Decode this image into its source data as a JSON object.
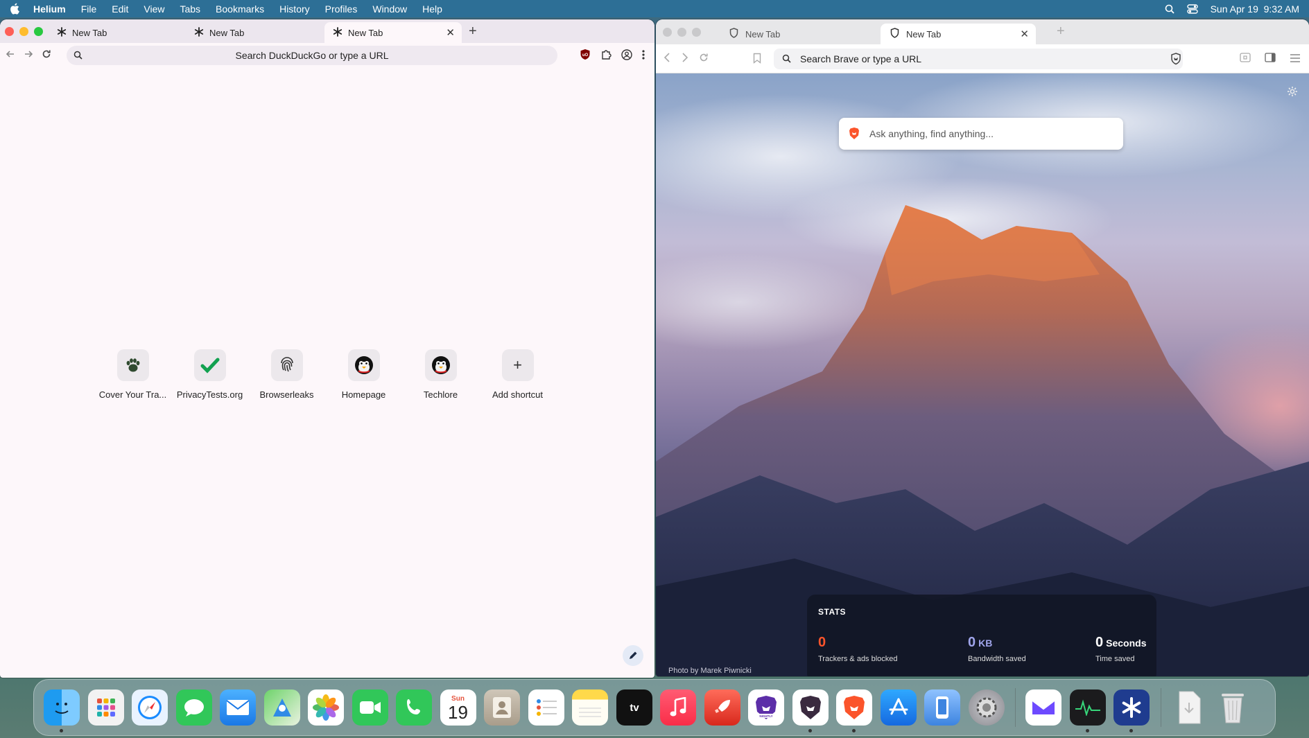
{
  "menubar": {
    "app_name": "Helium",
    "items": [
      "File",
      "Edit",
      "View",
      "Tabs",
      "Bookmarks",
      "History",
      "Profiles",
      "Window",
      "Help"
    ],
    "datetime": "Sun Apr 19  9:32 AM"
  },
  "helium": {
    "tabs": [
      {
        "title": "New Tab",
        "active": false
      },
      {
        "title": "New Tab",
        "active": false
      },
      {
        "title": "New Tab",
        "active": true
      }
    ],
    "new_tab_glyph": "+",
    "omnibox_placeholder": "Search DuckDuckGo or type a URL",
    "shortcuts": [
      {
        "label": "Cover Your Tra...",
        "icon": "bear-paw-icon"
      },
      {
        "label": "PrivacyTests.org",
        "icon": "checkmark-icon"
      },
      {
        "label": "Browserleaks",
        "icon": "fingerprint-icon"
      },
      {
        "label": "Homepage",
        "icon": "penguin-icon"
      },
      {
        "label": "Techlore",
        "icon": "penguin-icon"
      },
      {
        "label": "Add shortcut",
        "icon": "plus-icon"
      }
    ],
    "add_glyph": "+"
  },
  "brave": {
    "tabs": [
      {
        "title": "New Tab",
        "active": false
      },
      {
        "title": "New Tab",
        "active": true
      }
    ],
    "new_tab_glyph": "+",
    "omnibox_placeholder": "Search Brave or type a URL",
    "ntp_search_placeholder": "Ask anything, find anything...",
    "photo_credit": "Photo by Marek Piwnicki",
    "stats": {
      "title": "STATS",
      "trackers": {
        "value": "0",
        "unit": "",
        "caption": "Trackers & ads blocked",
        "color": "#fb542b"
      },
      "bandwidth": {
        "value": "0",
        "unit": "KB",
        "caption": "Bandwidth saved",
        "color": "#a0a5eb"
      },
      "time": {
        "value": "0",
        "unit": "Seconds",
        "caption": "Time saved",
        "color": "#ffffff"
      }
    }
  },
  "calendar": {
    "weekday": "Sun",
    "day": "19"
  },
  "dock": {
    "apps": [
      "Finder",
      "Launchpad",
      "Safari",
      "Messages",
      "Mail",
      "Maps",
      "Photos",
      "FaceTime",
      "Phone",
      "Calendar",
      "Contacts",
      "Reminders",
      "Notes",
      "TV",
      "Music",
      "Rocket",
      "Brave Nightly",
      "Brave Dev",
      "Brave",
      "App Store",
      "iPhone Mirroring",
      "System Settings",
      "Proton Mail",
      "Activity Monitor",
      "Helium",
      "Downloads",
      "Trash"
    ]
  }
}
